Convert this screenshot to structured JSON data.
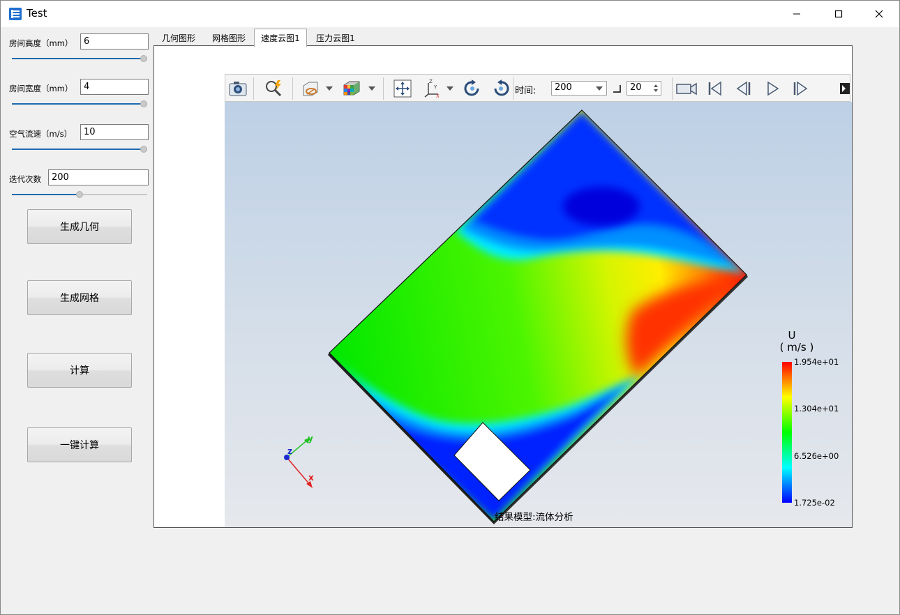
{
  "window": {
    "title": "Test"
  },
  "params": [
    {
      "label": "房间高度（mm）",
      "value": "6",
      "slider": 1.0
    },
    {
      "label": "房间宽度（mm）",
      "value": "4",
      "slider": 1.0
    },
    {
      "label": "空气流速（m/s）",
      "value": "10",
      "slider": 1.0
    },
    {
      "label": "迭代次数",
      "value": "200",
      "slider": 0.5
    }
  ],
  "buttons": {
    "geometry": "生成几何",
    "mesh": "生成网格",
    "compute": "计算",
    "one_click": "一键计算"
  },
  "tabs": [
    "几何图形",
    "网格图形",
    "速度云图1",
    "压力云图1"
  ],
  "active_tab": "速度云图1",
  "toolbar": {
    "time_label": "时间:",
    "time_value": "200",
    "step_value": "20"
  },
  "viewer": {
    "legend_title": "U",
    "legend_unit": "( m/s )",
    "legend_ticks": [
      "1.954e+01",
      "1.304e+01",
      "6.526e+00",
      "1.725e-02"
    ],
    "model_caption": "结果模型:流体分析",
    "axis_labels": {
      "x": "x",
      "y": "y",
      "z": "z"
    }
  },
  "colors": {
    "accent": "#1e6ab0",
    "legend_top": "#ff0000",
    "legend_bottom": "#0000ff"
  }
}
